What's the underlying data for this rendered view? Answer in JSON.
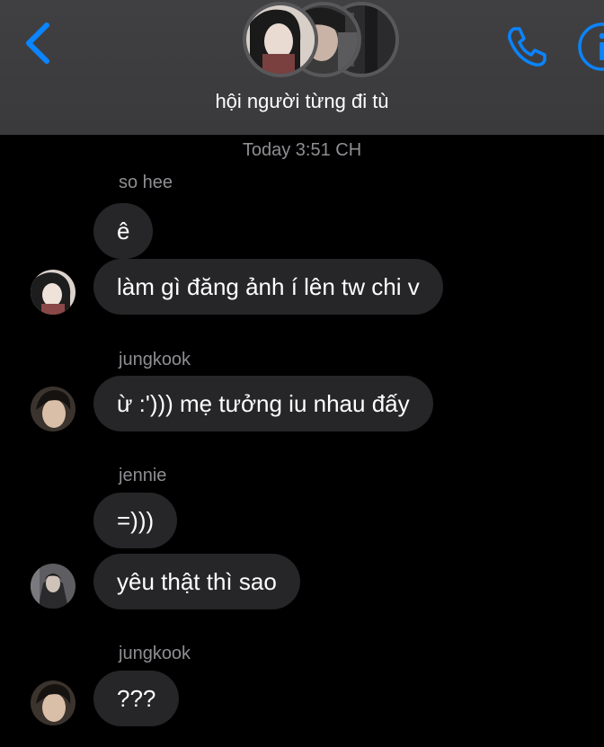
{
  "header": {
    "title": "hội người từng đi tù",
    "accent_color": "#0a84ff",
    "back_icon": "chevron-left-icon",
    "call_icon": "phone-icon",
    "info_icon": "info-icon"
  },
  "chat": {
    "timestamp": "Today 3:51 CH",
    "groups": [
      {
        "sender": "so hee",
        "messages": [
          "ê",
          "làm gì đăng ảnh í lên tw chi v"
        ]
      },
      {
        "sender": "jungkook",
        "messages": [
          "ừ :')))  mẹ tưởng iu nhau đấy"
        ]
      },
      {
        "sender": "jennie",
        "messages": [
          "=)))",
          "yêu thật thì sao"
        ]
      },
      {
        "sender": "jungkook",
        "messages": [
          "???"
        ]
      }
    ]
  }
}
